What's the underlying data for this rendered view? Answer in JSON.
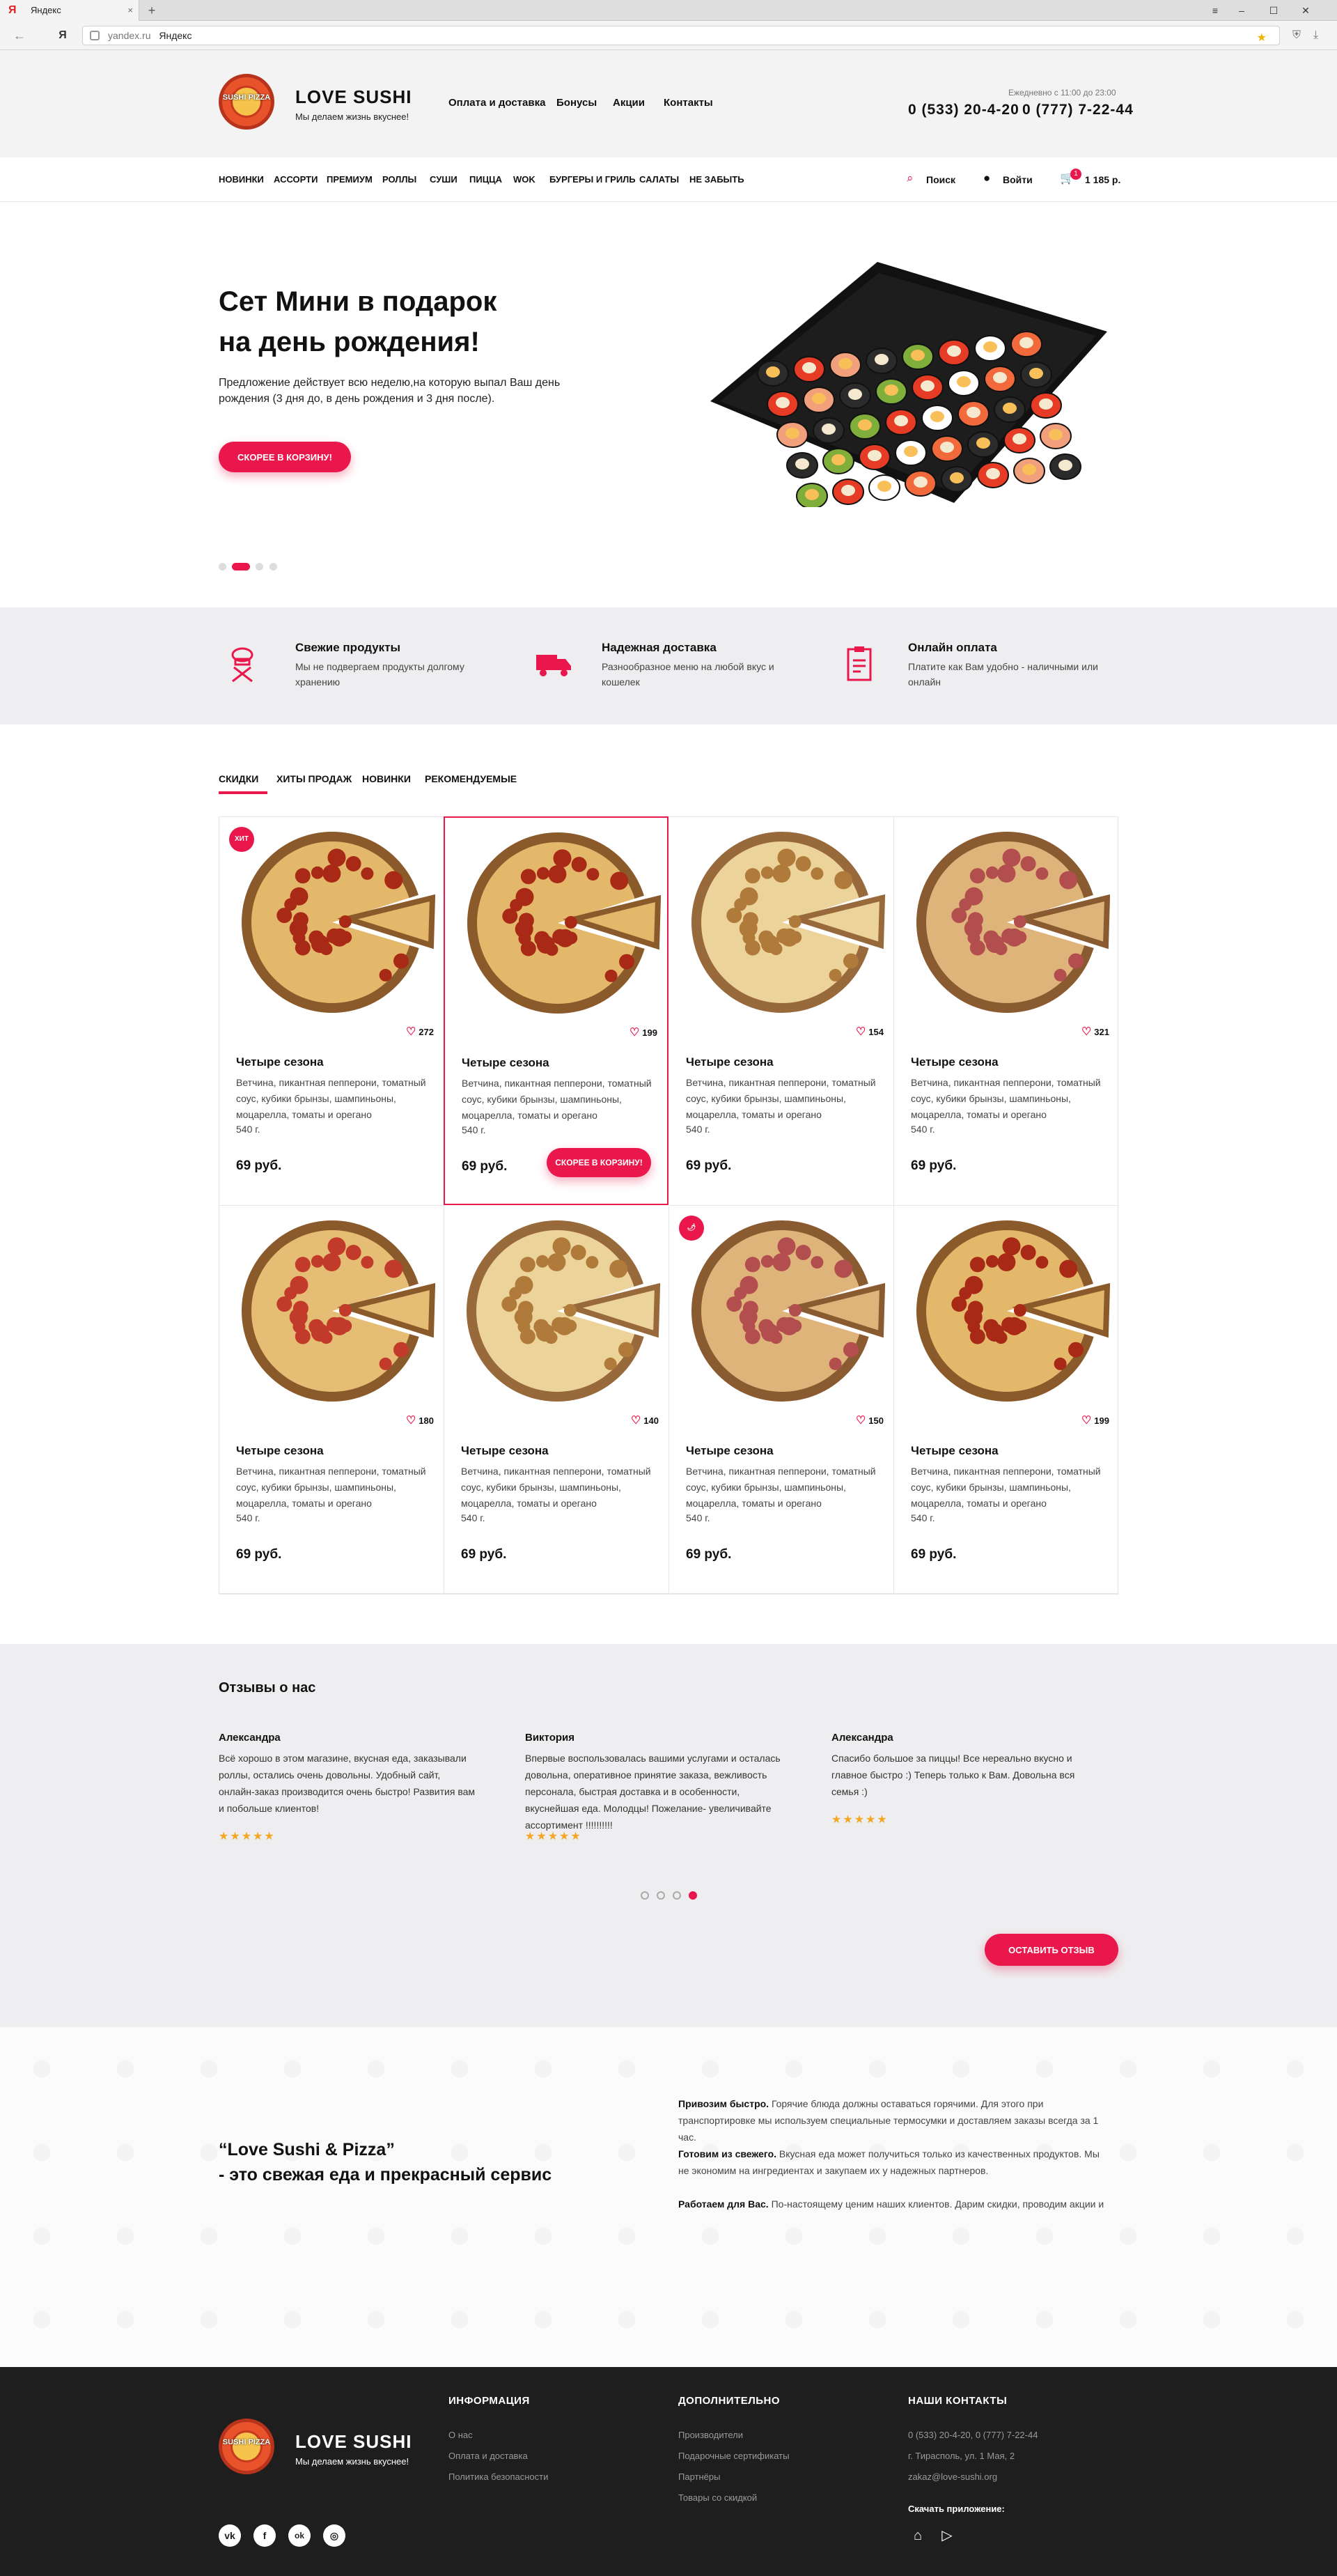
{
  "browser": {
    "tab_title": "Яндекс",
    "tab_close": "×",
    "new_tab": "+",
    "yandex_letter": "Я",
    "url_domain": "yandex.ru",
    "url_title": "Яндекс",
    "win_min": "–",
    "win_max": "☐",
    "win_close": "✕",
    "menu": "≡",
    "back": "←",
    "star": "★",
    "download": "⤓"
  },
  "header": {
    "brand": "LOVE SUSHI",
    "tagline": "Мы делаем жизнь вкуснее!",
    "logo_text": "SUSHI PIZZA",
    "nav": [
      "Оплата и доставка",
      "Бонусы",
      "Акции",
      "Контакты"
    ],
    "hours": "Ежедневно с 11:00 до 23:00",
    "phone1": "0 (533) 20-4-20",
    "phone2": "0 (777) 7-22-44"
  },
  "catnav": {
    "items": [
      "НОВИНКИ",
      "АССОРТИ",
      "ПРЕМИУМ",
      "РОЛЛЫ",
      "СУШИ",
      "ПИЦЦА",
      "WOK",
      "БУРГЕРЫ И ГРИЛЬ",
      "САЛАТЫ",
      "НЕ ЗАБЫТЬ"
    ],
    "search": "Поиск",
    "login": "Войти",
    "cart_count": "1",
    "cart_total": "1 185 р."
  },
  "hero": {
    "title_line1": "Сет Мини в подарок",
    "title_line2": "на день рождения!",
    "text": "Предложение действует всю неделю,на которую выпал Ваш день рождения (3 дня до, в день рождения и 3 дня после).",
    "button": "СКОРЕЕ В КОРЗИНУ!",
    "slides": 4,
    "active_slide": 2
  },
  "features": [
    {
      "title": "Свежие продукты",
      "text": "Мы не подвергаем продукты долгому хранению",
      "icon": "chef-icon"
    },
    {
      "title": "Надежная доставка",
      "text": "Разнообразное меню на любой вкус и кошелек",
      "icon": "truck-icon"
    },
    {
      "title": "Онлайн оплата",
      "text": "Платите как Вам удобно - наличными или онлайн",
      "icon": "receipt-icon"
    }
  ],
  "product_tabs": [
    "СКИДКИ",
    "ХИТЫ ПРОДАЖ",
    "НОВИНКИ",
    "РЕКОМЕНДУЕМЫЕ"
  ],
  "products": [
    {
      "name": "Четыре сезона",
      "desc": "Ветчина, пикантная пепперони, томатный соус, кубики брынзы, шампиньоны, моцарелла, томаты и орегано",
      "weight": "540 г.",
      "price": "69 руб.",
      "likes": "272",
      "badge": "ХИТ",
      "style": "pepperoni"
    },
    {
      "name": "Четыре сезона",
      "desc": "Ветчина, пикантная пепперони, томатный соус, кубики брынзы, шампиньоны, моцарелла, томаты и орегано",
      "weight": "540 г.",
      "price": "69 руб.",
      "likes": "199",
      "badge": "",
      "style": "pepperoni",
      "button": "СКОРЕЕ В КОРЗИНУ!"
    },
    {
      "name": "Четыре сезона",
      "desc": "Ветчина, пикантная пепперони, томатный соус, кубики брынзы, шампиньоны, моцарелла, томаты и орегано",
      "weight": "540 г.",
      "price": "69 руб.",
      "likes": "154",
      "badge": "",
      "style": "cheese"
    },
    {
      "name": "Четыре сезона",
      "desc": "Ветчина, пикантная пепперони, томатный соус, кубики брынзы, шампиньоны, моцарелла, томаты и орегано",
      "weight": "540 г.",
      "price": "69 руб.",
      "likes": "321",
      "badge": "",
      "style": "ham"
    },
    {
      "name": "Четыре сезона",
      "desc": "Ветчина, пикантная пепперони, томатный соус, кубики брынзы, шампиньоны, моцарелла, томаты и орегано",
      "weight": "540 г.",
      "price": "69 руб.",
      "likes": "180",
      "badge": "",
      "style": "olive"
    },
    {
      "name": "Четыре сезона",
      "desc": "Ветчина, пикантная пепперони, томатный соус, кубики брынзы, шампиньоны, моцарелла, томаты и орегано",
      "weight": "540 г.",
      "price": "69 руб.",
      "likes": "140",
      "badge": "",
      "style": "cheese"
    },
    {
      "name": "Четыре сезона",
      "desc": "Ветчина, пикантная пепперони, томатный соус, кубики брынзы, шампиньоны, моцарелла, томаты и орегано",
      "weight": "540 г.",
      "price": "69 руб.",
      "likes": "150",
      "badge": "🌶",
      "style": "ham"
    },
    {
      "name": "Четыре сезона",
      "desc": "Ветчина, пикантная пепперони, томатный соус, кубики брынзы, шампиньоны, моцарелла, томаты и орегано",
      "weight": "540 г.",
      "price": "69 руб.",
      "likes": "199",
      "badge": "",
      "style": "pepperoni"
    }
  ],
  "reviews": {
    "title": "Отзывы о нас",
    "items": [
      {
        "name": "Александра",
        "text": "Всё хорошо в этом магазине, вкусная еда, заказывали роллы, остались очень довольны. Удобный сайт, онлайн-заказ производится очень быстро! Развития вам и побольше клиентов!",
        "stars": "★★★★★"
      },
      {
        "name": "Виктория",
        "text": "Впервые воспользовалась вашими услугами и осталась довольна, оперативное принятие заказа, вежливость персонала, быстрая доставка и в особенности, вкуснейшая еда. Молодцы! Пожелание- увеличивайте ассортимент !!!!!!!!!!",
        "stars": "★★★★★"
      },
      {
        "name": "Александра",
        "text": "Спасибо большое за пиццы! Все нереально вкусно и главное быстро :) Теперь только к Вам. Довольна вся семья :)",
        "stars": "★★★★★"
      }
    ],
    "pages": 4,
    "active_page": 4,
    "button": "ОСТАВИТЬ ОТЗЫВ"
  },
  "about": {
    "headline1": "“Love Sushi & Pizza”",
    "headline2": " - это свежая еда и прекрасный сервис",
    "p1_bold": "Привозим быстро.",
    "p1": " Горячие блюда должны оставаться горячими. Для этого при транспортировке мы используем специальные термосумки и доставляем заказы всегда за 1 час.",
    "p2_bold": "Готовим из свежего.",
    "p2": " Вкусная еда может получиться только из качественных продуктов. Мы не экономим на ингредиентах и закупаем их у надежных партнеров.",
    "p3_bold": "Работаем для Вас.",
    "p3": " По-настоящему ценим наших клиентов. Дарим скидки, проводим акции и"
  },
  "footer": {
    "brand": "LOVE SUSHI",
    "tagline": "Мы делаем жизнь вкуснее!",
    "col1_title": "ИНФОРМАЦИЯ",
    "col1": [
      "О нас",
      "Оплата и доставка",
      "Политика безопасности"
    ],
    "col2_title": "ДОПОЛНИТЕЛЬНО",
    "col2": [
      "Производители",
      "Подарочные сертификаты",
      "Партнёры",
      "Товары со скидкой"
    ],
    "col3_title": "НАШИ КОНТАКТЫ",
    "col3": [
      "0 (533) 20-4-20, 0 (777) 7-22-44",
      "г. Тирасполь, ул. 1 Мая, 2",
      "zakaz@love-sushi.org"
    ],
    "app_label": "Скачать приложение:",
    "social": [
      "vk",
      "f",
      "ok",
      "◎"
    ]
  },
  "colors": {
    "accent": "#e9174b",
    "dark": "#1e1e1f",
    "star": "#f5a623"
  }
}
